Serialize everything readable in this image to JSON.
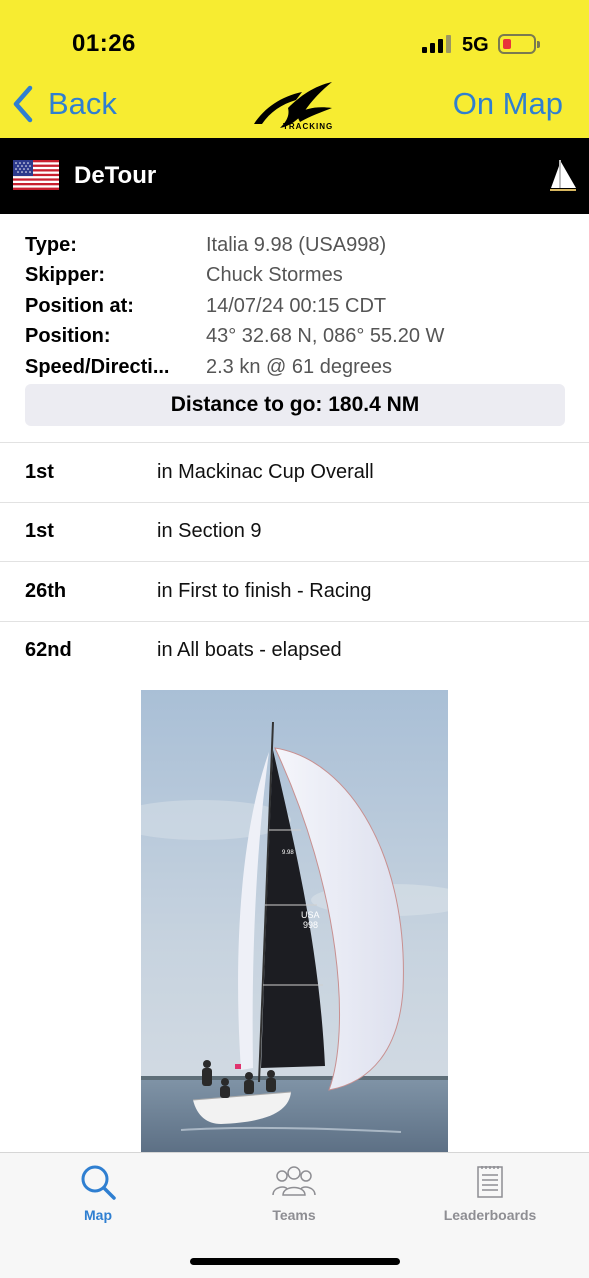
{
  "status_bar": {
    "time": "01:26",
    "network": "5G",
    "battery_color": "#e8343a"
  },
  "nav": {
    "back_label": "Back",
    "on_map_label": "On Map",
    "logo_text": "TRACKING",
    "accent_color": "#2f7fd1",
    "bar_color": "#f7ec31"
  },
  "boat": {
    "flag_icon": "usa-flag-icon",
    "name": "DeTour",
    "sail_icon": "sailboat-icon"
  },
  "details": [
    {
      "label": "Type:",
      "value": "Italia 9.98 (USA998)"
    },
    {
      "label": "Skipper:",
      "value": "Chuck Stormes"
    },
    {
      "label": "Position at:",
      "value": "14/07/24 00:15 CDT"
    },
    {
      "label": "Position:",
      "value": "43° 32.68 N, 086° 55.20 W"
    },
    {
      "label": "Speed/Directi...",
      "value": "2.3 kn @ 61 degrees"
    }
  ],
  "distance_to_go": "Distance to go: 180.4 NM",
  "rankings": [
    {
      "position": "1st",
      "description": "in Mackinac Cup Overall"
    },
    {
      "position": "1st",
      "description": "in Section 9"
    },
    {
      "position": "26th",
      "description": "in First to finish - Racing"
    },
    {
      "position": "62nd",
      "description": "in All boats - elapsed"
    }
  ],
  "photo": {
    "sail_text_1": "USA",
    "sail_text_2": "998",
    "logo_text": "9.98"
  },
  "tabbar": {
    "tabs": [
      {
        "label": "Map",
        "icon": "search-icon",
        "active": true
      },
      {
        "label": "Teams",
        "icon": "people-icon",
        "active": false
      },
      {
        "label": "Leaderboards",
        "icon": "clipboard-icon",
        "active": false
      }
    ]
  }
}
